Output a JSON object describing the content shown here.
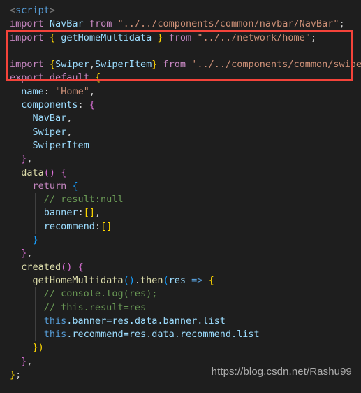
{
  "editor": {
    "background_color": "#1e1e1e",
    "language": "vue",
    "font_size_px": 13.5
  },
  "annotation": {
    "type": "rectangle-highlight",
    "color": "#f4433a",
    "covers_lines": [
      2,
      3,
      4
    ],
    "note": "red box drawn around the getHomeMultidata and Swiper imports"
  },
  "watermark": {
    "text": "https://blog.csdn.net/Rashu99"
  },
  "code": {
    "lines": [
      {
        "n": 1,
        "text": "<script>"
      },
      {
        "n": 2,
        "text": "import NavBar from \"../../components/common/navbar/NavBar\";"
      },
      {
        "n": 3,
        "text": "import { getHomeMultidata } from \"../../network/home\";"
      },
      {
        "n": 4,
        "text": ""
      },
      {
        "n": 5,
        "text": "import {Swiper,SwiperItem} from '../../components/common/swiper'"
      },
      {
        "n": 6,
        "text": "export default {"
      },
      {
        "n": 7,
        "text": "  name: \"Home\","
      },
      {
        "n": 8,
        "text": "  components: {"
      },
      {
        "n": 9,
        "text": "    NavBar,"
      },
      {
        "n": 10,
        "text": "    Swiper,"
      },
      {
        "n": 11,
        "text": "    SwiperItem"
      },
      {
        "n": 12,
        "text": "  },"
      },
      {
        "n": 13,
        "text": "  data() {"
      },
      {
        "n": 14,
        "text": "    return {"
      },
      {
        "n": 15,
        "text": "      // result:null"
      },
      {
        "n": 16,
        "text": "      banner:[],"
      },
      {
        "n": 17,
        "text": "      recommend:[]"
      },
      {
        "n": 18,
        "text": "    }"
      },
      {
        "n": 19,
        "text": "  },"
      },
      {
        "n": 20,
        "text": "  created() {"
      },
      {
        "n": 21,
        "text": "    getHomeMultidata().then(res => {"
      },
      {
        "n": 22,
        "text": "      // console.log(res);"
      },
      {
        "n": 23,
        "text": "      // this.result=res"
      },
      {
        "n": 24,
        "text": "      this.banner=res.data.banner.list"
      },
      {
        "n": 25,
        "text": "      this.recommend=res.data.recommend.list"
      },
      {
        "n": 26,
        "text": "    })"
      },
      {
        "n": 27,
        "text": "  },"
      },
      {
        "n": 28,
        "text": "};"
      }
    ]
  },
  "tokens": {
    "l1": {
      "open": "<",
      "tag": "script",
      "close": ">"
    },
    "l2": {
      "import": "import",
      "name": "NavBar",
      "from": "from",
      "path": "\"../../components/common/navbar/NavBar\"",
      "semi": ";"
    },
    "l3": {
      "import": "import",
      "brace_open": "{",
      "name": "getHomeMultidata",
      "brace_close": "}",
      "from": "from",
      "path": "\"../../network/home\"",
      "semi": ";"
    },
    "l5": {
      "import": "import",
      "brace_open": "{",
      "name1": "Swiper",
      "comma": ",",
      "name2": "SwiperItem",
      "brace_close": "}",
      "from": "from",
      "path": "'../../components/common/swiper'"
    },
    "l6": {
      "export": "export",
      "default": "default",
      "brace": "{"
    },
    "l7": {
      "key": "name",
      "colon": ":",
      "value": "\"Home\"",
      "comma": ","
    },
    "l8": {
      "key": "components",
      "colon": ":",
      "brace": "{"
    },
    "l9": {
      "name": "NavBar",
      "comma": ","
    },
    "l10": {
      "name": "Swiper",
      "comma": ","
    },
    "l11": {
      "name": "SwiperItem"
    },
    "l12": {
      "brace": "}",
      "comma": ","
    },
    "l13": {
      "fn": "data",
      "parens": "()",
      "brace": "{"
    },
    "l14": {
      "kw": "return",
      "brace": "{"
    },
    "l15": {
      "comment": "// result:null"
    },
    "l16": {
      "key": "banner",
      "colon": ":",
      "brackets": "[]",
      "comma": ","
    },
    "l17": {
      "key": "recommend",
      "colon": ":",
      "brackets": "[]"
    },
    "l18": {
      "brace": "}"
    },
    "l19": {
      "brace": "}",
      "comma": ","
    },
    "l20": {
      "fn": "created",
      "parens": "()",
      "brace": "{"
    },
    "l21": {
      "fn": "getHomeMultidata",
      "parens": "()",
      "dot": ".",
      "then": "then",
      "paren_open": "(",
      "arg": "res",
      "arrow": "=>",
      "brace": "{"
    },
    "l22": {
      "comment": "// console.log(res);"
    },
    "l23": {
      "comment": "// this.result=res"
    },
    "l24": {
      "this": "this",
      "prop": ".banner=res.data.banner.list"
    },
    "l25": {
      "this": "this",
      "prop": ".recommend=res.data.recommend.list"
    },
    "l26": {
      "close": "})"
    },
    "l27": {
      "brace": "}",
      "comma": ","
    },
    "l28": {
      "brace": "}",
      "semi": ";"
    }
  }
}
